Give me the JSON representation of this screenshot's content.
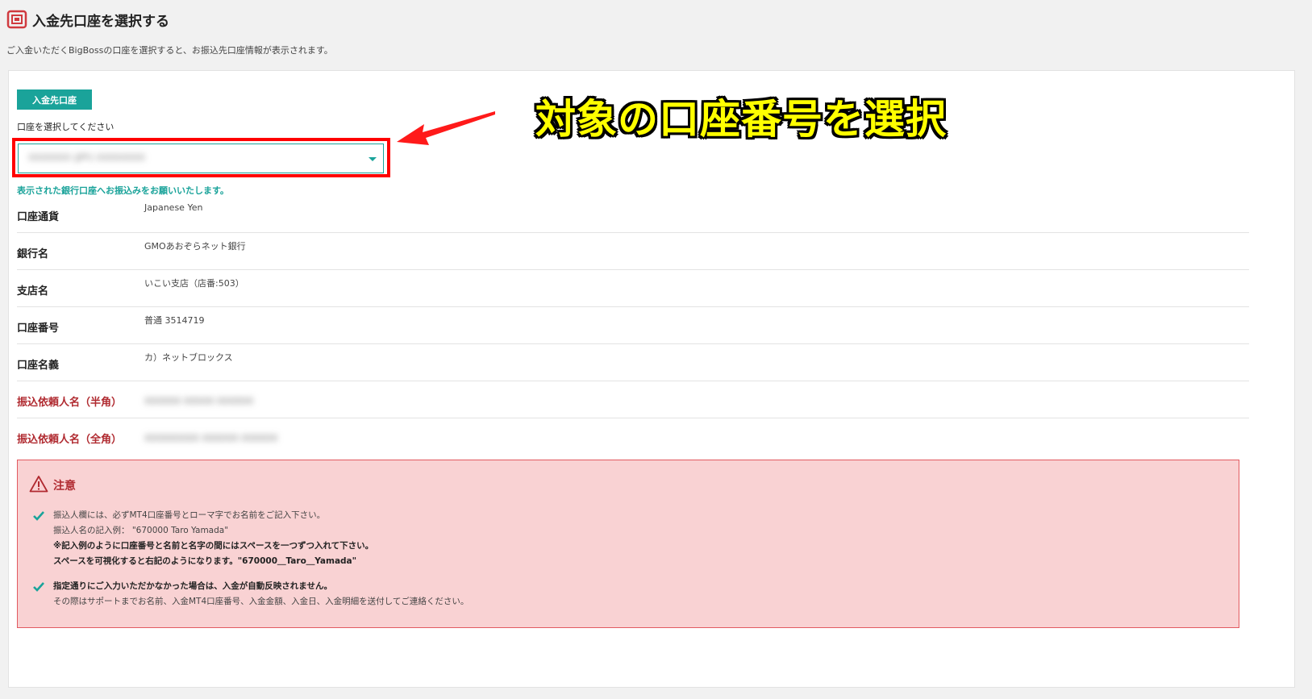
{
  "header": {
    "title": "入金先口座を選択する",
    "description": "ご入金いただくBigBossの口座を選択すると、お振込先口座情報が表示されます。"
  },
  "form": {
    "section_badge": "入金先口座",
    "select_label": "口座を選択してください",
    "select_value": "XXXXXXX (JPY) XXXXXXXX",
    "notice": "表示された銀行口座へお振込みをお願いいたします。"
  },
  "info_rows": [
    {
      "label": "口座通貨",
      "value": "Japanese Yen"
    },
    {
      "label": "銀行名",
      "value": "GMOあおぞらネット銀行"
    },
    {
      "label": "支店名",
      "value": "いこい支店（店番:503）"
    },
    {
      "label": "口座番号",
      "value": "普通 3514719"
    },
    {
      "label": "口座名義",
      "value": "カ）ネットブロックス"
    },
    {
      "label": "振込依頼人名（半角）",
      "value": "XXXXXX XXXXX XXXXXX"
    },
    {
      "label": "振込依頼人名（全角）",
      "value": "XXXXXXXXX XXXXXX XXXXXX"
    }
  ],
  "caution": {
    "title": "注意",
    "item1": {
      "line1": "振込人欄には、必ずMT4口座番号とローマ字でお名前をご記入下さい。",
      "line2": "振込人名の記入例：  \"670000 Taro Yamada\"",
      "line3": "※記入例のように口座番号と名前と名字の間にはスペースを一つずつ入れて下さい。",
      "line4": "スペースを可視化すると右記のようになります。\"670000＿Taro＿Yamada\""
    },
    "item2": {
      "line1": "指定通りにご入力いただかなかった場合は、入金が自動反映されません。",
      "line2": "その際はサポートまでお名前、入金MT4口座番号、入金金額、入金日、入金明細を送付してご連絡ください。"
    }
  },
  "annotation": {
    "text": "対象の口座番号を選択"
  },
  "colors": {
    "accent": "#1aa39a",
    "warning_red": "#b02a30",
    "caution_bg": "#f9d2d3",
    "highlight": "#ff0000",
    "annotation_text": "#ffff00"
  }
}
